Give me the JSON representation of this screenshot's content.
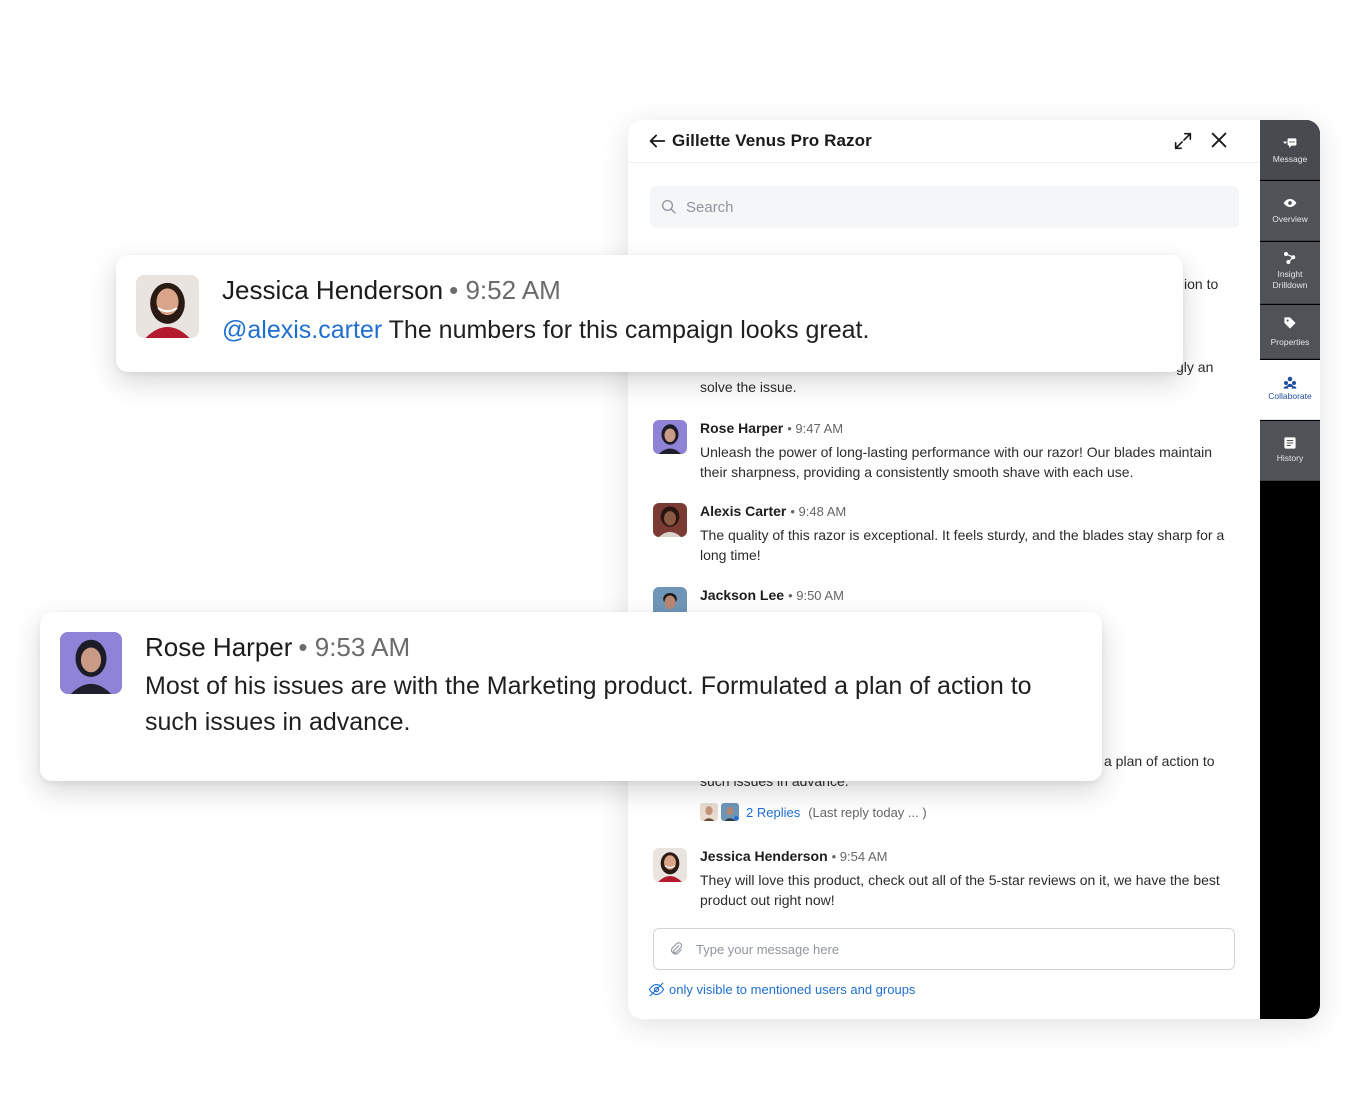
{
  "panel": {
    "title": "Gillette Venus Pro Razor",
    "search_placeholder": "Search"
  },
  "hidden_fragments": {
    "frag1": "ion to",
    "frag2": "gly an",
    "frag3": "solve the issue.",
    "frag4": "a plan of action to",
    "frag5": "such issues in advance."
  },
  "messages": [
    {
      "name": "Rose Harper",
      "time": "• 9:47 AM",
      "text": "Unleash the power of long-lasting performance with our razor! Our blades maintain their sharpness, providing a consistently smooth shave with each use."
    },
    {
      "name": "Alexis Carter",
      "time": "• 9:48 AM",
      "text": "The quality of this razor is exceptional. It feels sturdy, and the blades stay sharp for a long time!"
    },
    {
      "name": "Jackson Lee",
      "time": "• 9:50 AM",
      "text": ""
    },
    {
      "name": "Jessica Henderson",
      "time": "• 9:54 AM",
      "text": "They will love this product, check out all of the 5-star reviews on it, we have the best product out right now!"
    }
  ],
  "replies": {
    "link": "2 Replies",
    "last": "(Last reply today ... )"
  },
  "composer": {
    "placeholder": "Type your message here"
  },
  "visibility_note": "only visible to mentioned users and groups",
  "rail": [
    {
      "label": "Message",
      "icon": "message-icon"
    },
    {
      "label": "Overview",
      "icon": "eye-icon"
    },
    {
      "label": "Insight Drilldown",
      "icon": "drilldown-icon"
    },
    {
      "label": "Properties",
      "icon": "tag-icon"
    },
    {
      "label": "Collaborate",
      "icon": "collaborate-icon"
    },
    {
      "label": "History",
      "icon": "history-icon"
    }
  ],
  "cards": {
    "card1": {
      "name": "Jessica Henderson",
      "time": "• 9:52 AM",
      "mention": "@alexis.carter",
      "text": " The numbers for this campaign looks great."
    },
    "card2": {
      "name": "Rose Harper",
      "time": "• 9:53 AM",
      "text": "Most of his issues are with the Marketing product. Formulated a plan of action to such issues in advance."
    }
  },
  "colors": {
    "accent": "#1f6fd1",
    "rail_bg": "#000000",
    "rail_item": "#4f5358",
    "rail_active": "#ffffff"
  }
}
